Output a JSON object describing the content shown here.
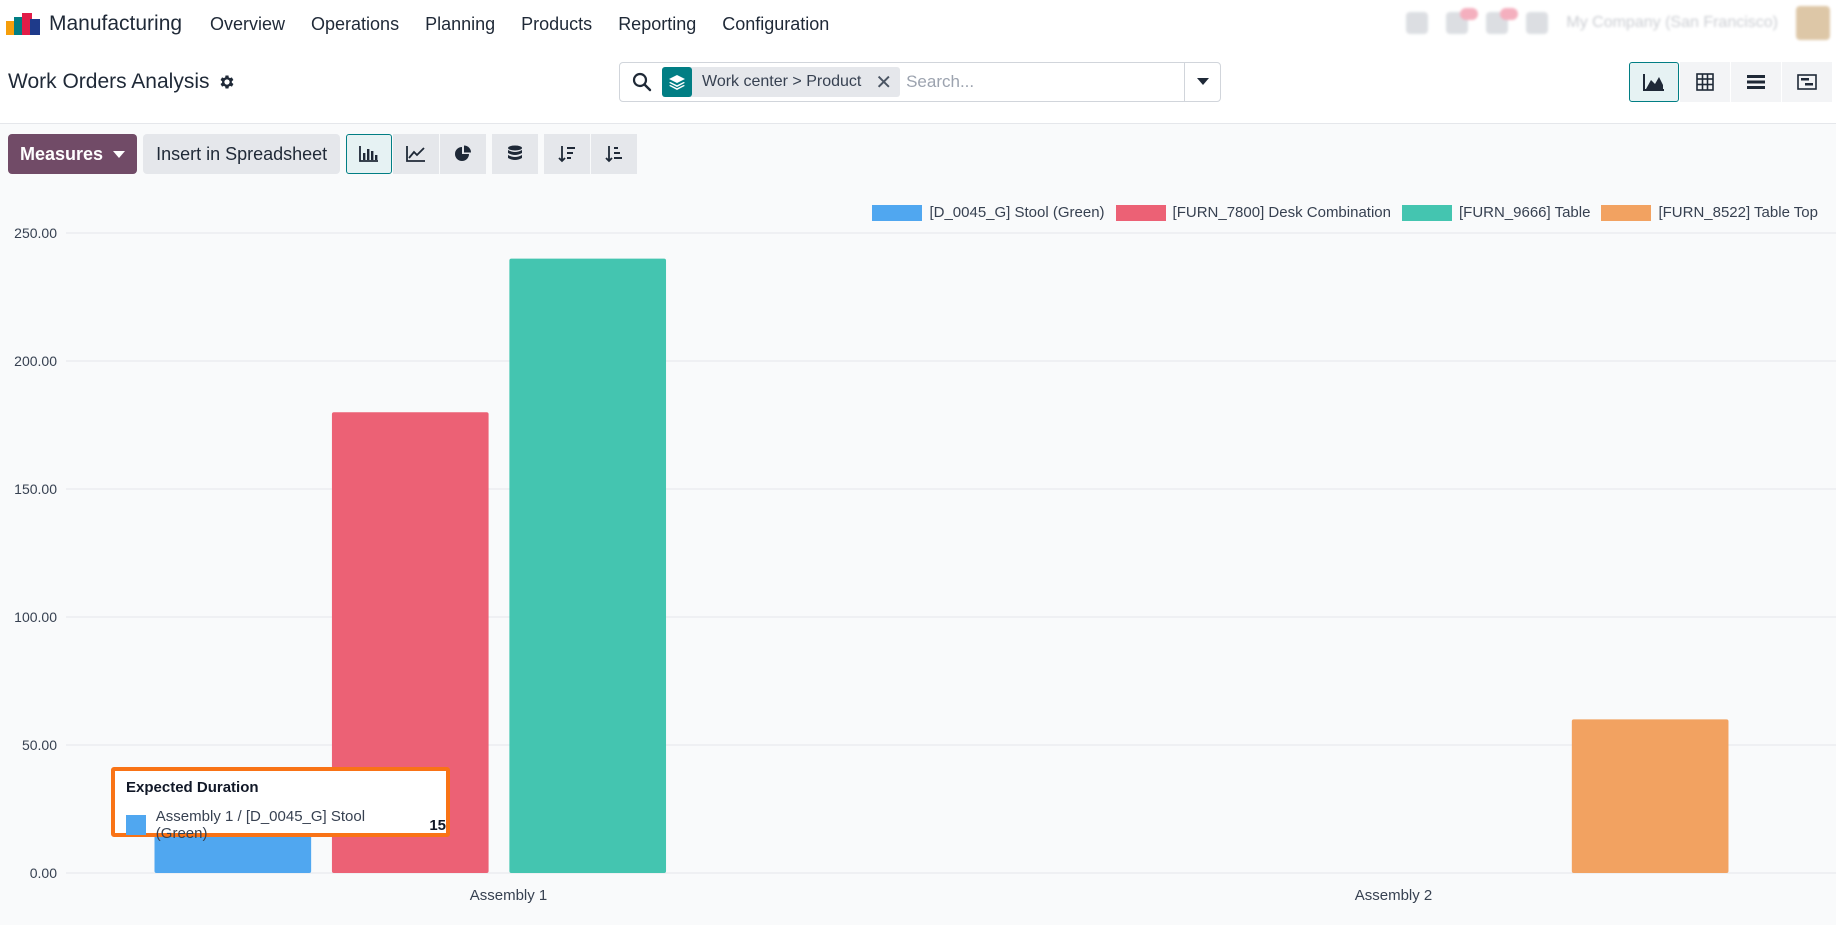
{
  "app": {
    "name": "Manufacturing"
  },
  "menu": [
    "Overview",
    "Operations",
    "Planning",
    "Products",
    "Reporting",
    "Configuration"
  ],
  "systray": {
    "company": "My Company (San Francisco)"
  },
  "control": {
    "title": "Work Orders Analysis",
    "facet_parts": [
      "Work center",
      ">",
      "Product"
    ],
    "facet_text": "Work center > Product",
    "search_placeholder": "Search..."
  },
  "toolbar": {
    "measures_label": "Measures",
    "insert_label": "Insert in Spreadsheet"
  },
  "colors": {
    "brand": "#714b67",
    "accent": "#017e84"
  },
  "chart_data": {
    "type": "bar",
    "categories": [
      "Assembly 1",
      "Assembly 2"
    ],
    "series": [
      {
        "name": "[D_0045_G] Stool (Green)",
        "color": "#50a7f0",
        "values": [
          15,
          null
        ]
      },
      {
        "name": "[FURN_7800] Desk Combination",
        "color": "#ec6175",
        "values": [
          180,
          null
        ]
      },
      {
        "name": "[FURN_9666] Table",
        "color": "#44c5b0",
        "values": [
          240,
          null
        ]
      },
      {
        "name": "[FURN_8522] Table Top",
        "color": "#f2a261",
        "values": [
          null,
          60
        ]
      }
    ],
    "yticks": [
      "0.00",
      "50.00",
      "100.00",
      "150.00",
      "200.00",
      "250.00"
    ],
    "ylim": [
      0,
      250
    ],
    "grid": true,
    "legend": "top-right"
  },
  "tooltip": {
    "title": "Expected Duration",
    "label": "Assembly 1 / [D_0045_G] Stool (Green)",
    "value": "15"
  }
}
